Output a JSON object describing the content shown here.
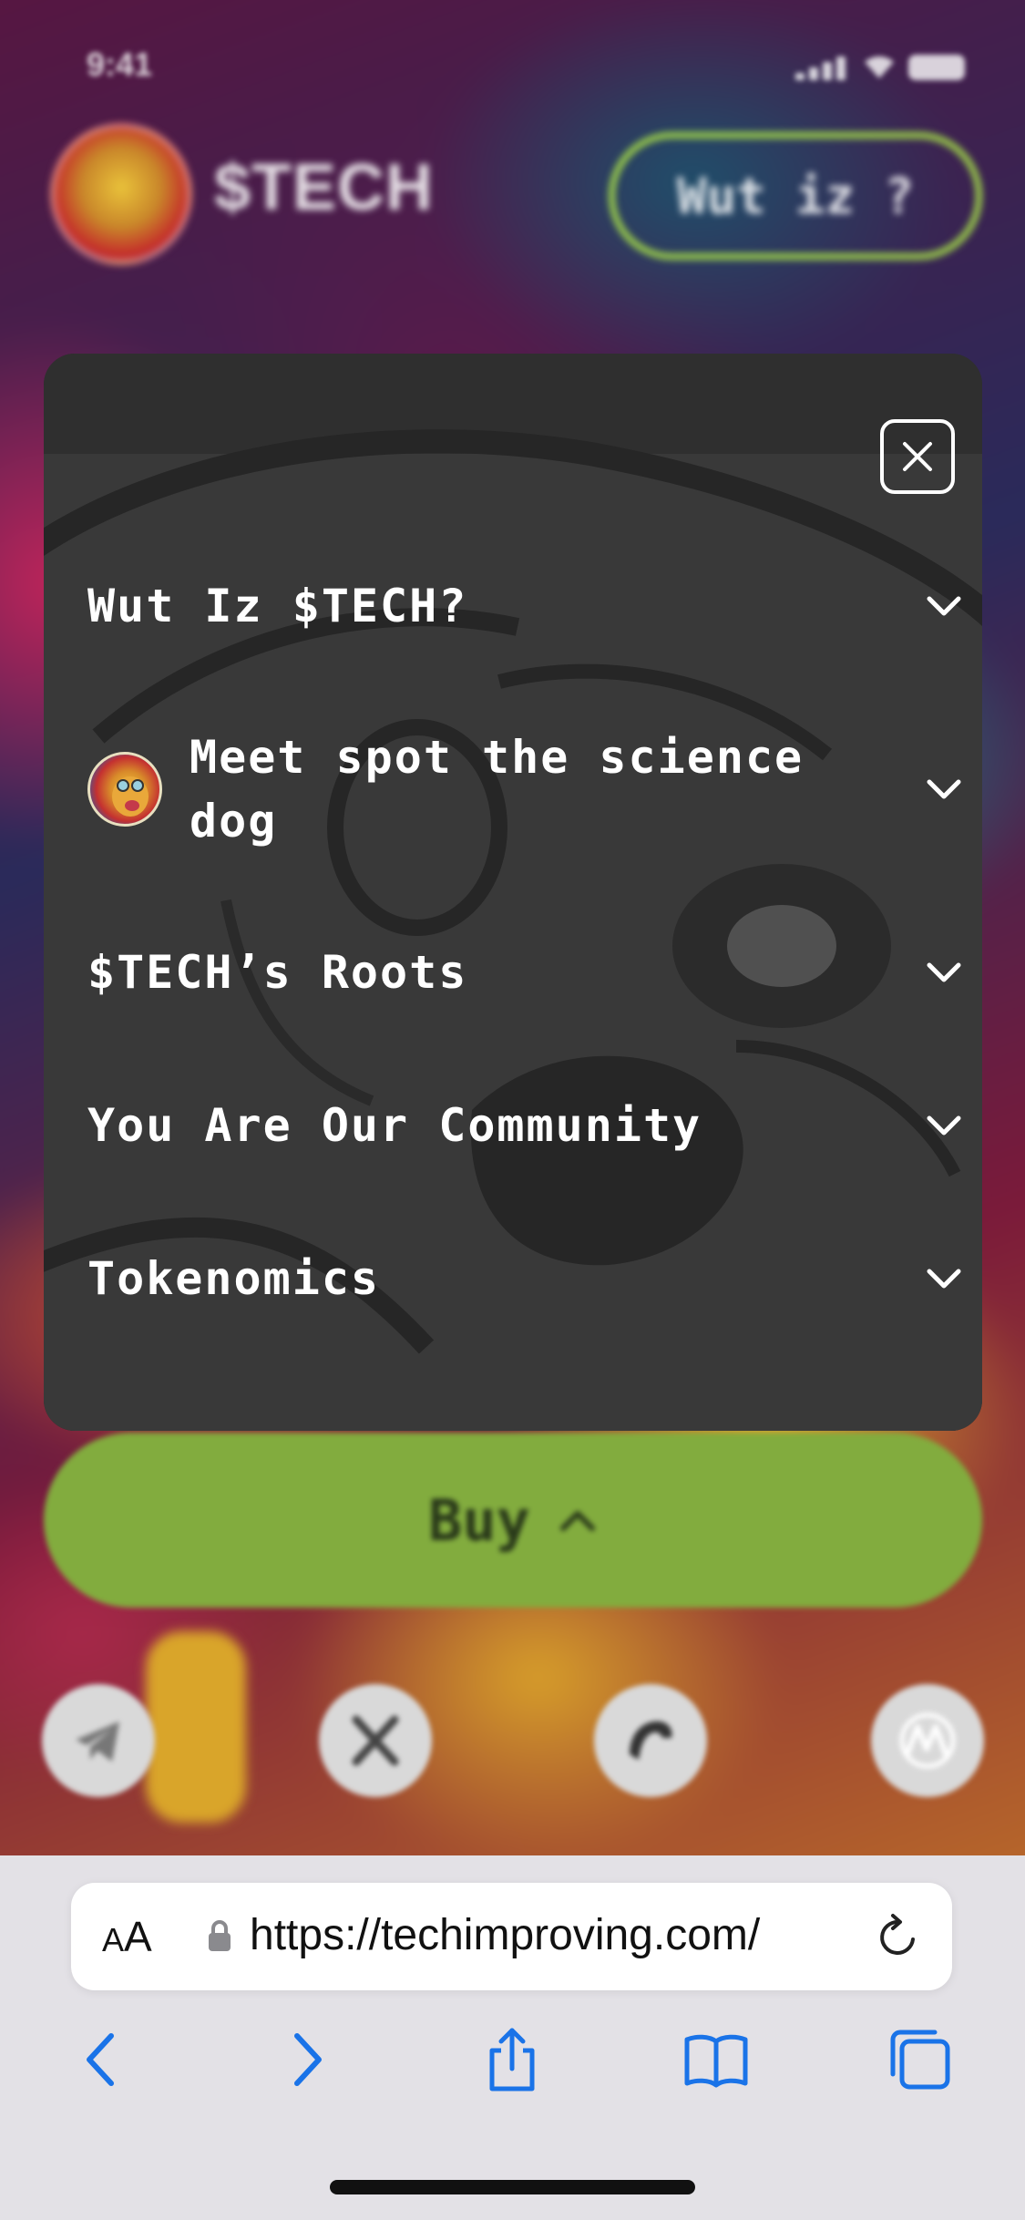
{
  "status_bar": {
    "time": "9:41"
  },
  "site_header": {
    "brand": "$TECH",
    "nav_button": "Wut iz ?"
  },
  "menu": {
    "items": [
      {
        "label": "Wut Iz $TECH?",
        "has_avatar": false
      },
      {
        "label_line1": "Meet spot the science",
        "label_line2": "dog",
        "has_avatar": true
      },
      {
        "label": "$TECH’s Roots",
        "has_avatar": false
      },
      {
        "label": "You Are Our Community",
        "has_avatar": false
      },
      {
        "label": "Tokenomics",
        "has_avatar": false
      }
    ]
  },
  "buy_button": {
    "label": "Buy"
  },
  "socials": [
    "telegram-icon",
    "x-icon",
    "bird-icon",
    "coinmarketcap-icon"
  ],
  "browser": {
    "text_size_button": {
      "small": "A",
      "big": "A"
    },
    "url": "https://techimproving.com/"
  },
  "colors": {
    "accent_green": "#82ac3e",
    "header_button_border": "#9ed24a",
    "modal_bg": "#2f2f2f",
    "safari_blue": "#1a73e8",
    "safari_bg": "#e3e1e6"
  }
}
